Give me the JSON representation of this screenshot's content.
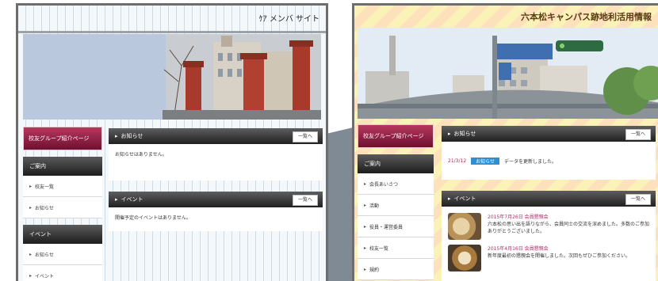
{
  "left_site": {
    "title": "ｹｱ メンバ サイト",
    "sidebar": {
      "banner": "校友グループ紹介ページ",
      "headings": [
        "ご案内",
        "イベント"
      ],
      "items": [
        "校友一覧",
        "お知らせ",
        "お知らせ",
        "イベント"
      ]
    },
    "main": {
      "notices_heading": "お知らせ",
      "notices_body": "お知らせはありません。",
      "events_heading": "イベント",
      "events_body": "開催予定のイベントはありません。",
      "more_label": "一覧へ"
    }
  },
  "right_site": {
    "title": "六本松キャンパス跡地利活用情報",
    "sidebar": {
      "banner": "校友グループ紹介ページ",
      "heading": "ご案内",
      "items": [
        "会長あいさつ",
        "活動",
        "役員・運営委員",
        "校友一覧",
        "規約"
      ]
    },
    "main": {
      "notices_heading": "お知らせ",
      "notice_date": "21/3/12",
      "notice_tag": "お知らせ",
      "notice_text": "データを更新しました。",
      "events_heading": "イベント",
      "more_label": "一覧へ",
      "events": [
        {
          "title": "2015年7月26日  会員懇親会",
          "body": "六本松の思い出を語りながら、会員同士の交流を深めました。多数のご参加ありがとうございました。"
        },
        {
          "title": "2015年4月16日  会員懇親会",
          "body": "新年度最初の懇親会を開催しました。次回もぜひご参加ください。"
        }
      ]
    }
  },
  "colors": {
    "banner": "#8a1c40",
    "dark_bar": "#2b2b2b",
    "brick": "#a83a2c",
    "notice_tag": "#2f8fd0"
  }
}
